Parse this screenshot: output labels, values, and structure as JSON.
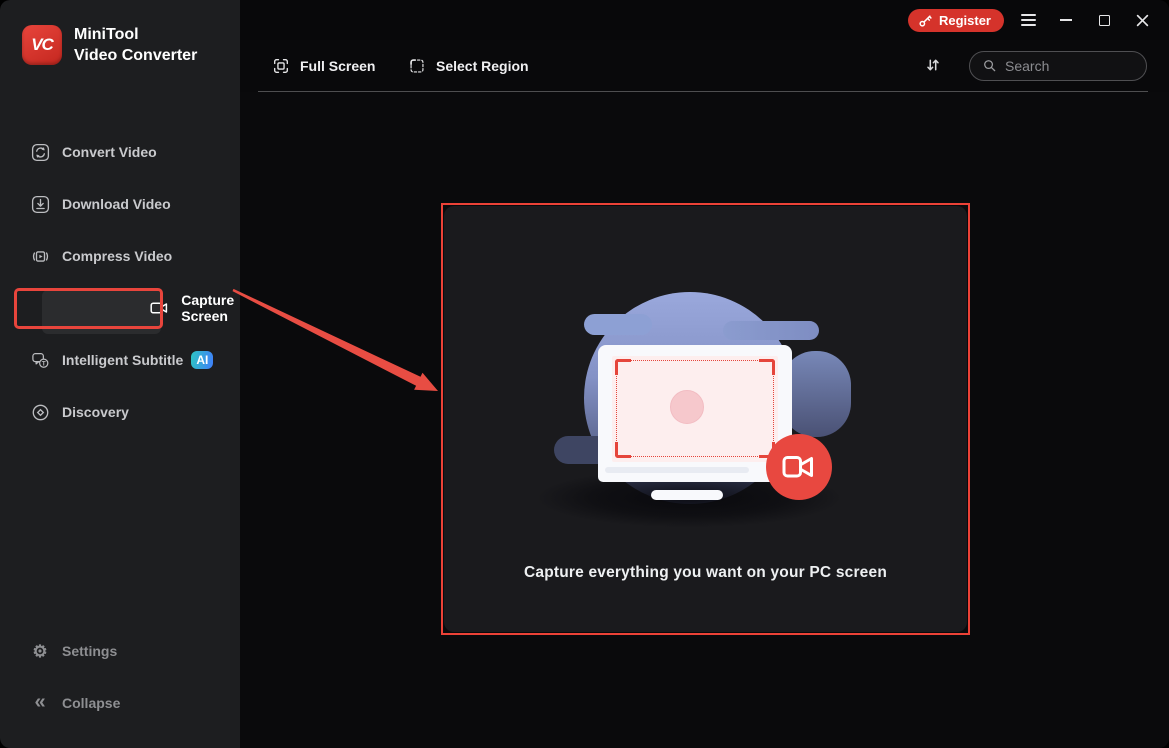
{
  "app": {
    "brand": {
      "logo": "VC",
      "line1": "MiniTool",
      "line2": "Video Converter"
    }
  },
  "titlebar": {
    "register_label": "Register"
  },
  "sidebar": {
    "items": [
      {
        "label": "Convert Video",
        "icon": "convert-icon",
        "active": false
      },
      {
        "label": "Download Video",
        "icon": "download-icon",
        "active": false
      },
      {
        "label": "Compress Video",
        "icon": "compress-icon",
        "active": false
      },
      {
        "label": "Capture Screen",
        "icon": "capture-icon",
        "active": true
      },
      {
        "label": "Intelligent Subtitle",
        "icon": "subtitle-icon",
        "active": false,
        "badge": "AI"
      },
      {
        "label": "Discovery",
        "icon": "discovery-icon",
        "active": false
      }
    ],
    "footer": [
      {
        "label": "Settings",
        "icon": "gear-icon"
      },
      {
        "label": "Collapse",
        "icon": "collapse-icon"
      }
    ]
  },
  "topbar": {
    "full_screen": "Full Screen",
    "select_region": "Select Region",
    "search_placeholder": "Search"
  },
  "main": {
    "caption": "Capture everything you want on your PC screen"
  },
  "icons": {
    "settings_glyph": "⚙",
    "collapse_glyph": "«"
  },
  "colors": {
    "accent_red": "#e8453c",
    "register_red": "#d5332b",
    "record_button_red": "#e84840",
    "ai_badge_gradient": [
      "#2ec6c3",
      "#3f7efb"
    ],
    "blob_periwinkle": "#97a5d8",
    "sidebar_bg": "#1d1e20",
    "main_bg": "#0a0a0c",
    "panel_bg": "#1a1a1d"
  }
}
